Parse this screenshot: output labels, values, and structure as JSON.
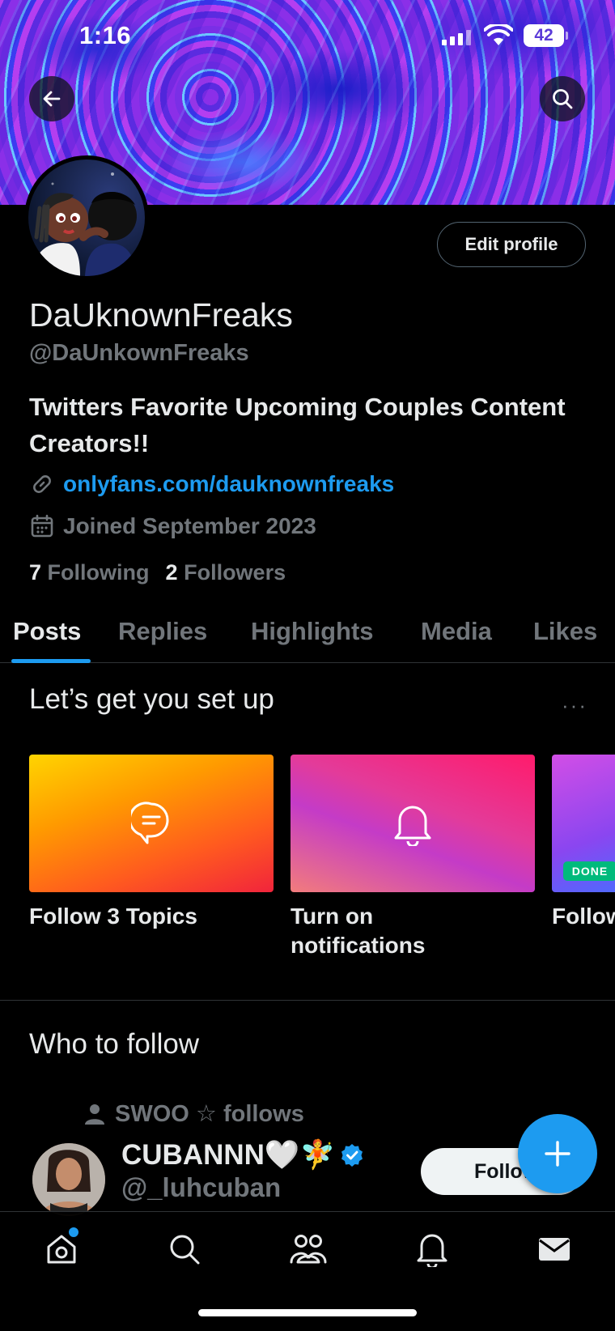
{
  "status_bar": {
    "time": "1:16",
    "battery": "42"
  },
  "profile": {
    "display_name": "DaUknownFreaks",
    "handle": "@DaUnkownFreaks",
    "bio": "Twitters Favorite Upcoming Couples Content Creators!!",
    "link": "onlyfans.com/dauknownfreaks",
    "joined": "Joined September 2023",
    "following_count": "7",
    "following_label": "Following",
    "followers_count": "2",
    "followers_label": "Followers",
    "edit_profile_label": "Edit profile"
  },
  "tabs": [
    {
      "label": "Posts",
      "active": true
    },
    {
      "label": "Replies"
    },
    {
      "label": "Highlights"
    },
    {
      "label": "Media"
    },
    {
      "label": "Likes"
    }
  ],
  "setup": {
    "title": "Let’s get you set up",
    "more": "···",
    "cards": [
      {
        "label": "Follow 3 Topics",
        "icon": "topic-bubble-icon"
      },
      {
        "label": "Turn on notifications",
        "icon": "bell-icon"
      },
      {
        "label": "Follow",
        "badge": "DONE"
      }
    ]
  },
  "who_to_follow": {
    "title": "Who to follow",
    "social_context": "SWOO ☆ follows",
    "user": {
      "name": "CUBANNN🤍🧚",
      "handle": "@_luhcuban",
      "verified": true,
      "follow_label": "Follow"
    }
  },
  "bottom_nav": [
    "home-icon",
    "search-icon",
    "communities-icon",
    "notifications-icon",
    "messages-icon"
  ],
  "colors": {
    "accent": "#1d9bf0",
    "background": "#000000",
    "secondary_text": "#71767b",
    "done": "#00ba7c"
  }
}
